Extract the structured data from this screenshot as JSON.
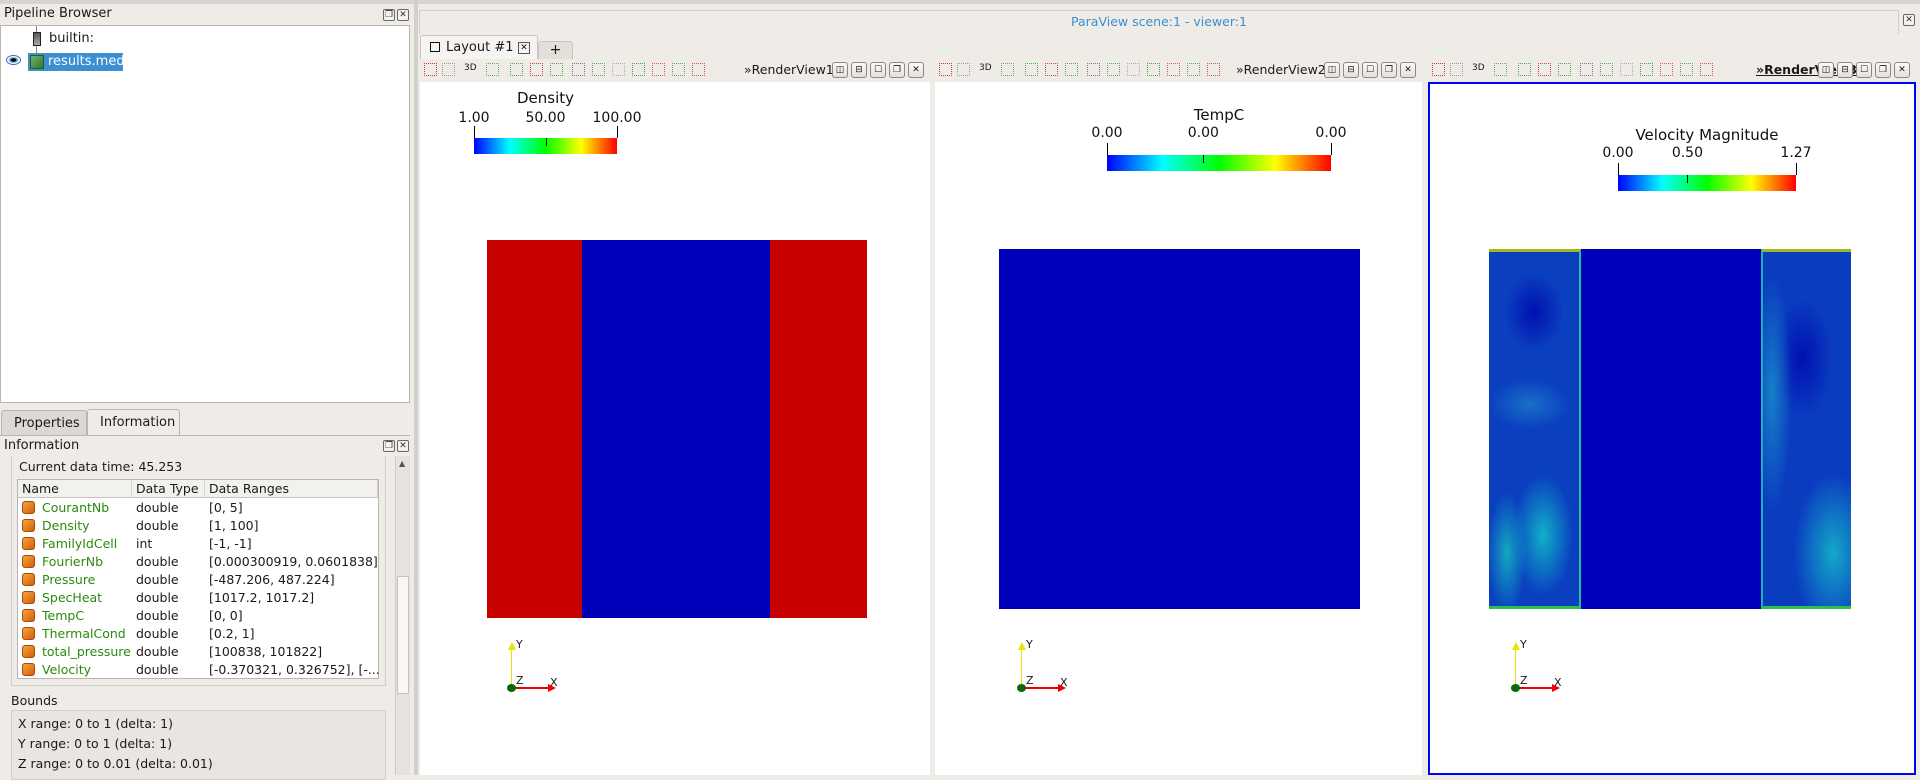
{
  "pipeline": {
    "title": "Pipeline Browser",
    "items": [
      {
        "label": "builtin:"
      },
      {
        "label": "results.med"
      }
    ]
  },
  "panel_tabs": [
    {
      "label": "Properties"
    },
    {
      "label": "Information"
    }
  ],
  "info": {
    "title": "Information",
    "current_time": "Current data time: 45.253",
    "columns": [
      "Name",
      "Data Type",
      "Data Ranges"
    ],
    "rows": [
      {
        "name": "CourantNb",
        "type": "double",
        "range": "[0, 5]"
      },
      {
        "name": "Density",
        "type": "double",
        "range": "[1, 100]"
      },
      {
        "name": "FamilyIdCell",
        "type": "int",
        "range": "[-1, -1]"
      },
      {
        "name": "FourierNb",
        "type": "double",
        "range": "[0.000300919, 0.0601838]"
      },
      {
        "name": "Pressure",
        "type": "double",
        "range": "[-487.206, 487.224]"
      },
      {
        "name": "SpecHeat",
        "type": "double",
        "range": "[1017.2, 1017.2]"
      },
      {
        "name": "TempC",
        "type": "double",
        "range": "[0, 0]"
      },
      {
        "name": "ThermalCond",
        "type": "double",
        "range": "[0.2, 1]"
      },
      {
        "name": "total_pressure",
        "type": "double",
        "range": "[100838, 101822]"
      },
      {
        "name": "Velocity",
        "type": "double",
        "range": "[-0.370321, 0.326752], [-..."
      }
    ],
    "bounds_title": "Bounds",
    "bounds": [
      "X range:  0 to 1 (delta: 1)",
      "Y range:  0 to 1 (delta: 1)",
      "Z range:  0 to 0.01 (delta: 0.01)"
    ]
  },
  "main": {
    "title": "ParaView scene:1 - viewer:1",
    "layout_tab": "Layout #1",
    "add_tab": "+",
    "btn_3d": "3D"
  },
  "views": [
    {
      "name": "»RenderView1",
      "bar_title": "Density",
      "labels": [
        "1.00",
        "50.00",
        "100.00"
      ]
    },
    {
      "name": "»RenderView2",
      "bar_title": "TempC",
      "labels": [
        "0.00",
        "0.00",
        "0.00"
      ]
    },
    {
      "name": "»RenderView3",
      "bar_title": "Velocity Magnitude",
      "labels": [
        "0.00",
        "0.50",
        "1.27"
      ]
    }
  ],
  "axes": {
    "x": "X",
    "y": "Y",
    "z": "Z"
  },
  "colors": {
    "active_border": "#0000ff",
    "red": "#c80000",
    "blue": "#0000bb",
    "selection": "#3c8fd0"
  }
}
